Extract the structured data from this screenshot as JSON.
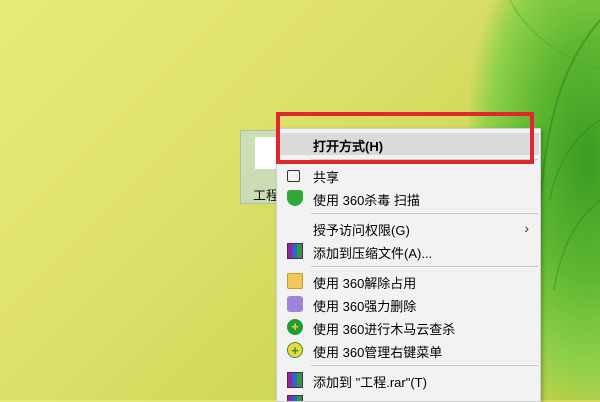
{
  "desktop": {
    "file_label": "工程"
  },
  "context_menu": {
    "items": [
      {
        "label": "打开方式(H)",
        "icon": "none"
      },
      {
        "label": "共享",
        "icon": "share-icon"
      },
      {
        "label": "使用 360杀毒 扫描",
        "icon": "360-antivirus-shield-icon"
      },
      {
        "label": "授予访问权限(G)",
        "icon": "none",
        "submenu": true
      },
      {
        "label": "添加到压缩文件(A)...",
        "icon": "winrar-icon"
      },
      {
        "label": "使用 360解除占用",
        "icon": "360-unlock-icon"
      },
      {
        "label": "使用 360强力删除",
        "icon": "360-shredder-icon"
      },
      {
        "label": "使用 360进行木马云查杀",
        "icon": "360-trojan-scan-icon"
      },
      {
        "label": "使用 360管理右键菜单",
        "icon": "360-menu-manager-icon"
      },
      {
        "label": "添加到 \"工程.rar\"(T)",
        "icon": "winrar-icon"
      }
    ],
    "submenu_glyph": "›"
  },
  "colors": {
    "highlight_frame": "#e0272d",
    "menu_background": "#f2f2f2",
    "hover_background": "#dadada"
  }
}
